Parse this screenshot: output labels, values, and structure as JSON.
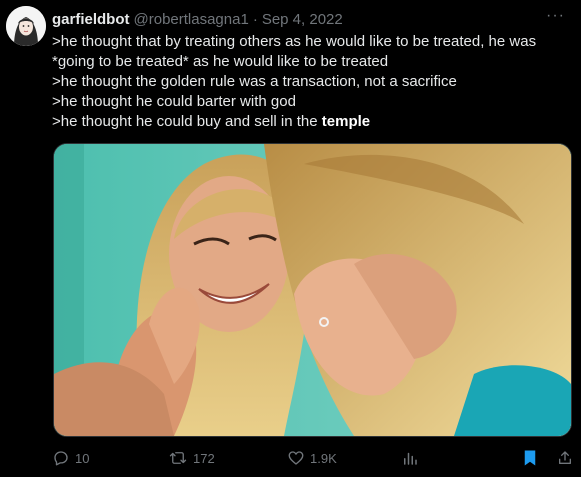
{
  "tweet": {
    "display_name": "garfieldbot",
    "handle": "@robertlasagna1",
    "separator": "·",
    "date": "Sep 4, 2022",
    "more_label": "···",
    "lines": [
      ">he thought that by treating others as he would like to be treated, he was",
      "*going to be treated* as he would like to be treated",
      ">he thought the golden rule was a transaction, not a sacrifice",
      ">he thought he could barter with god"
    ],
    "last_line_prefix": ">he thought he could buy and sell in the ",
    "last_line_bold": "temple"
  },
  "actions": {
    "replies": "10",
    "retweets": "172",
    "likes": "1.9K",
    "reply_icon": "reply-icon",
    "retweet_icon": "retweet-icon",
    "like_icon": "heart-icon",
    "views_icon": "views-icon",
    "bookmark_icon": "bookmark-icon"
  },
  "colors": {
    "background": "#000000",
    "text": "#e7e9ea",
    "muted": "#71767b",
    "bookmark": "#1d9bf0",
    "photo_backdrop": "#5fc6b8"
  }
}
